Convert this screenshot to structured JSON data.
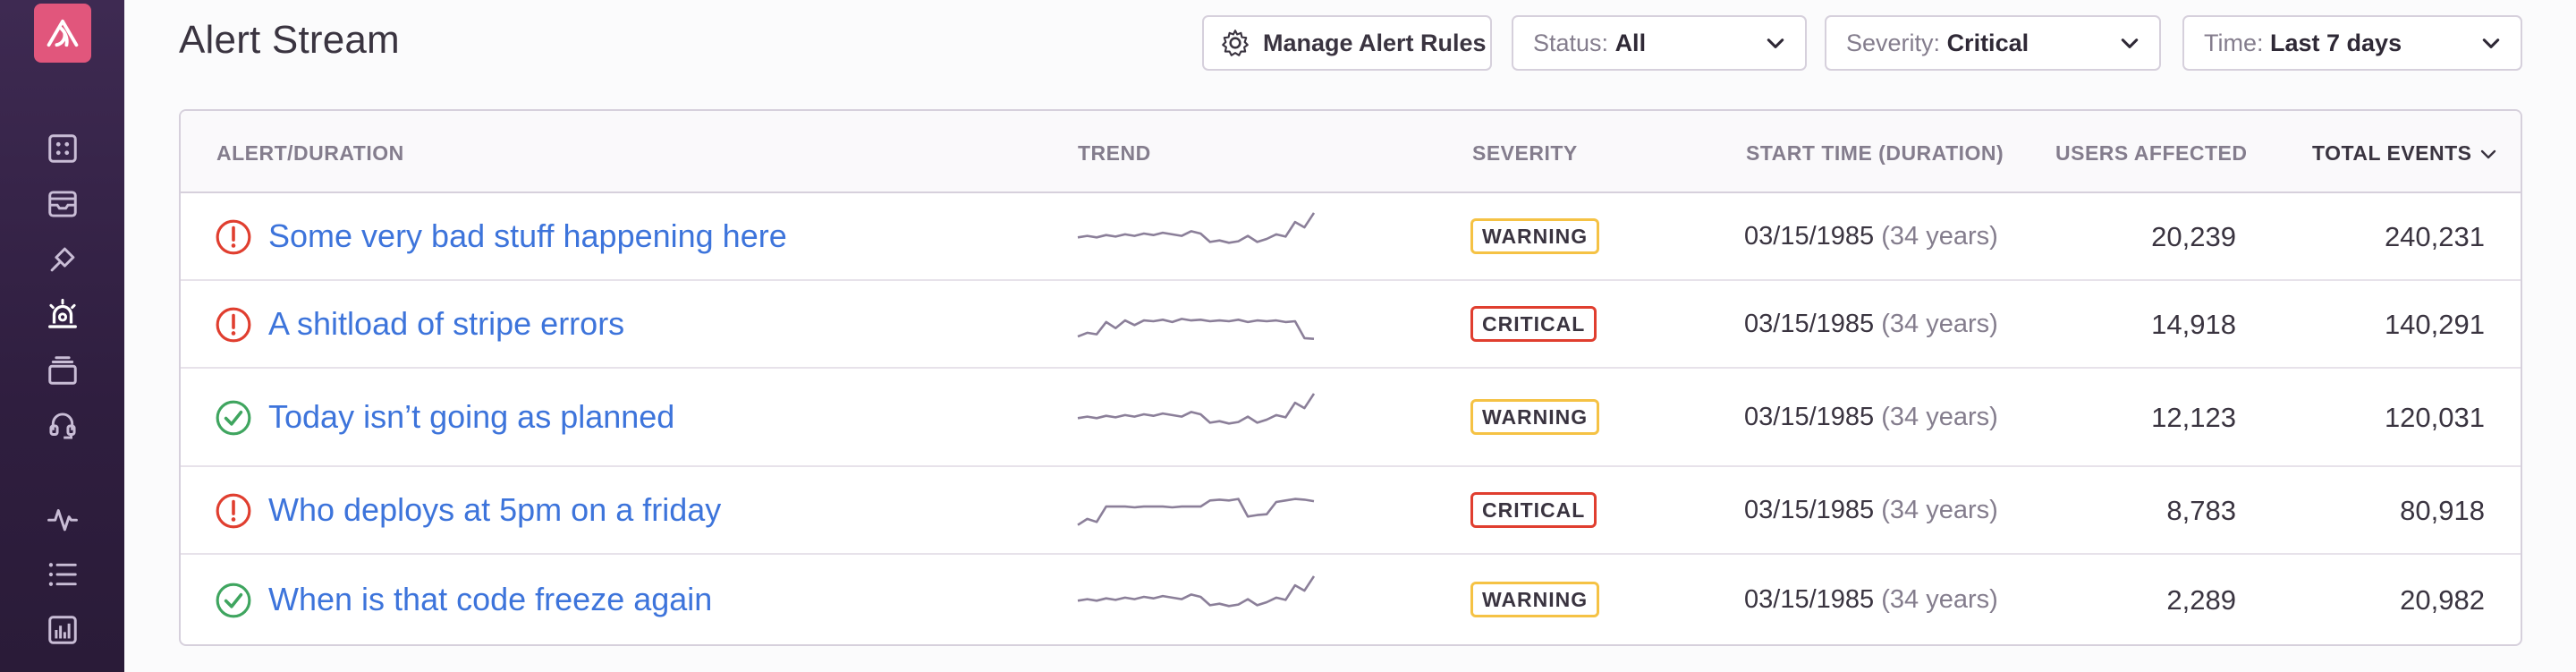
{
  "header": {
    "title": "Alert Stream",
    "manage_label": "Manage Alert Rules",
    "filters": {
      "status": {
        "label": "Status:",
        "value": "All"
      },
      "severity": {
        "label": "Severity:",
        "value": "Critical"
      },
      "time": {
        "label": "Time:",
        "value": "Last 7 days"
      }
    }
  },
  "sidebar": {
    "logo": "sentry-logo-icon",
    "items": [
      "dashboard-icon",
      "inbox-icon",
      "releases-icon",
      "alerts-icon",
      "archive-icon",
      "support-icon",
      "activity-icon",
      "list-icon",
      "stats-icon"
    ],
    "active": "alerts-icon"
  },
  "table": {
    "columns": {
      "alert": "ALERT/DURATION",
      "trend": "TREND",
      "severity": "SEVERITY",
      "start": "START TIME (DURATION)",
      "users": "USERS AFFECTED",
      "events": "TOTAL EVENTS"
    },
    "sorted_by": "events",
    "rows": [
      {
        "status": "open",
        "status_icon": "exclamation-circle-icon",
        "title": "Some very bad stuff happening here",
        "trend": [
          3,
          3.2,
          3,
          3.3,
          3.1,
          3.4,
          3.2,
          3.5,
          3.3,
          3.6,
          3.4,
          3.2,
          3.8,
          3.5,
          2.4,
          2.6,
          2.3,
          2.5,
          3.2,
          2.4,
          2.8,
          3.4,
          3.1,
          5,
          4.3,
          6.2
        ],
        "severity": "WARNING",
        "start_date": "03/15/1985",
        "duration": "(34 years)",
        "users": "20,239",
        "events": "240,231"
      },
      {
        "status": "open",
        "status_icon": "exclamation-circle-icon",
        "title": "A shitload of stripe errors",
        "trend": [
          1.5,
          2,
          1.8,
          3.4,
          2.6,
          3.6,
          3,
          3.6,
          3.5,
          3.7,
          3.4,
          3.8,
          3.6,
          3.7,
          3.5,
          3.6,
          3.5,
          3.7,
          3.4,
          3.6,
          3.5,
          3.6,
          3.4,
          3.5,
          1.3,
          1.2
        ],
        "severity": "CRITICAL",
        "start_date": "03/15/1985",
        "duration": "(34 years)",
        "users": "14,918",
        "events": "140,291"
      },
      {
        "status": "resolved",
        "status_icon": "check-circle-icon",
        "title": "Today isn’t going as planned",
        "trend": [
          3,
          3.2,
          3,
          3.3,
          3.1,
          3.4,
          3.2,
          3.5,
          3.3,
          3.6,
          3.4,
          3.2,
          3.8,
          3.5,
          2.4,
          2.6,
          2.3,
          2.5,
          3.2,
          2.4,
          2.8,
          3.4,
          3.1,
          5,
          4.3,
          6.2
        ],
        "severity": "WARNING",
        "start_date": "03/15/1985",
        "duration": "(34 years)",
        "users": "12,123",
        "events": "120,031"
      },
      {
        "status": "open",
        "status_icon": "exclamation-circle-icon",
        "title": "Who deploys at 5pm on a friday",
        "trend": [
          1.2,
          2,
          1.6,
          3.6,
          3.6,
          3.6,
          3.5,
          3.6,
          3.6,
          3.6,
          3.5,
          3.6,
          3.6,
          3.6,
          4.4,
          4.5,
          4.4,
          4.6,
          2.3,
          2.5,
          2.6,
          4.2,
          4.4,
          4.6,
          4.5,
          4.3
        ],
        "severity": "CRITICAL",
        "start_date": "03/15/1985",
        "duration": "(34 years)",
        "users": "8,783",
        "events": "80,918"
      },
      {
        "status": "resolved",
        "status_icon": "check-circle-icon",
        "title": "When is that code freeze again",
        "trend": [
          3,
          3.2,
          3,
          3.3,
          3.1,
          3.4,
          3.2,
          3.5,
          3.3,
          3.6,
          3.4,
          3.2,
          3.8,
          3.5,
          2.4,
          2.6,
          2.3,
          2.5,
          3.2,
          2.4,
          2.8,
          3.4,
          3.1,
          5,
          4.3,
          6.2
        ],
        "severity": "WARNING",
        "start_date": "03/15/1985",
        "duration": "(34 years)",
        "users": "2,289",
        "events": "20,982"
      }
    ]
  },
  "colors": {
    "sidebar_bg": "#3e2a52",
    "logo_bg": "#e1567c",
    "link": "#3d74db",
    "open_status": "#e03e2f",
    "resolved_status": "#3fa55f",
    "warning": "#f5c244",
    "critical": "#e03e2f",
    "sparkline": "#8b7f99"
  }
}
